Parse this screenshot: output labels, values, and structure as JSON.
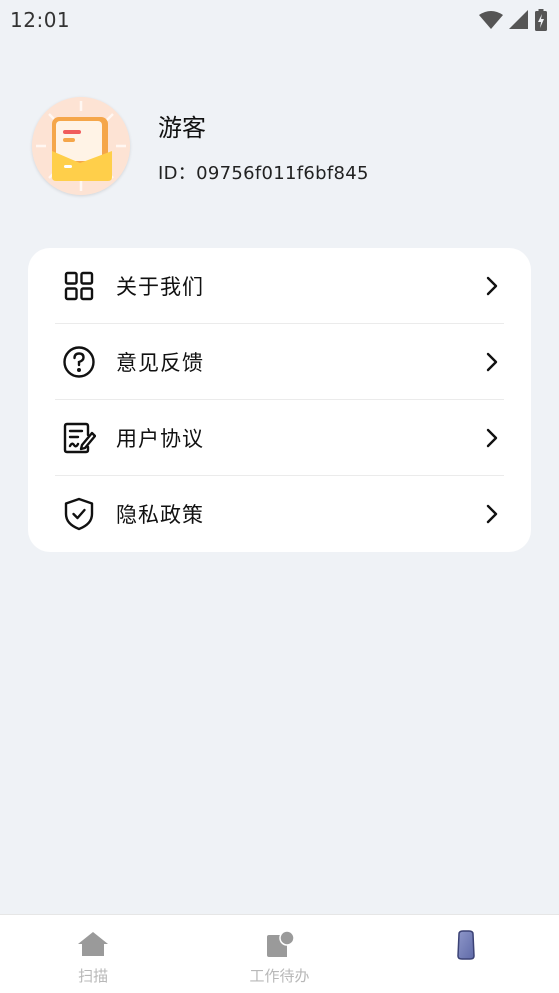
{
  "status_bar": {
    "time": "12:01"
  },
  "profile": {
    "name": "游客",
    "id_text": "ID：09756f011f6bf845"
  },
  "menu": {
    "items": [
      {
        "label": "关于我们",
        "icon": "grid-icon"
      },
      {
        "label": "意见反馈",
        "icon": "question-circle-icon"
      },
      {
        "label": "用户协议",
        "icon": "document-edit-icon"
      },
      {
        "label": "隐私政策",
        "icon": "shield-check-icon"
      }
    ]
  },
  "bottom_nav": {
    "tabs": [
      {
        "label": "扫描",
        "icon": "house-icon"
      },
      {
        "label": "工作待办",
        "icon": "note-icon"
      },
      {
        "label": "",
        "icon": "profile-icon"
      }
    ]
  },
  "colors": {
    "page_background": "#eff2f6",
    "card_background": "#ffffff",
    "nav_inactive": "#b8b8b8",
    "avatar_accent": "#f5a64a"
  }
}
